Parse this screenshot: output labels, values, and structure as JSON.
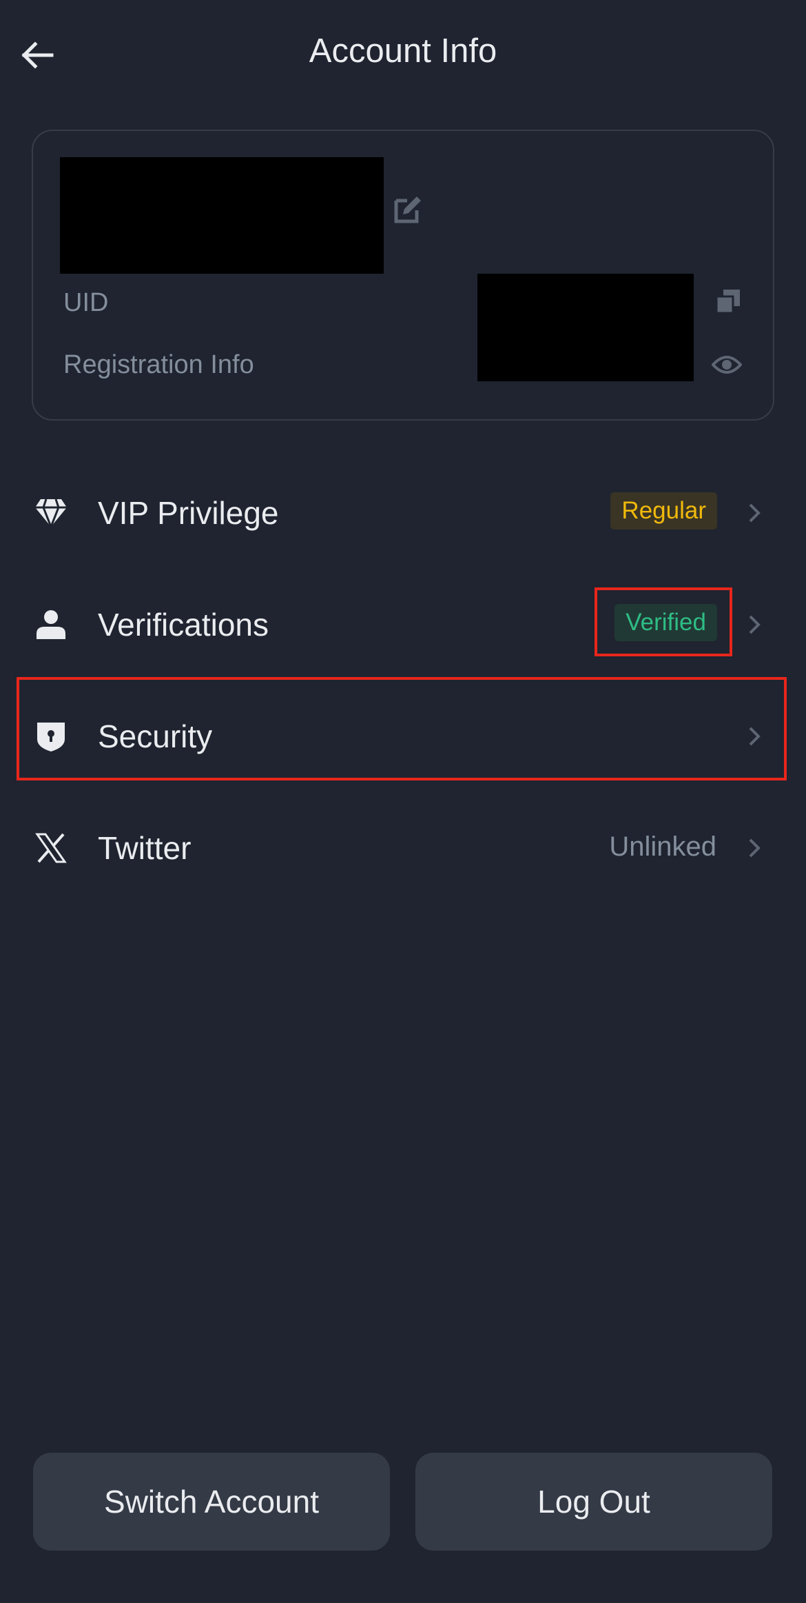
{
  "header": {
    "title": "Account Info",
    "back_icon": "arrow-left-icon"
  },
  "profile_card": {
    "uid_label": "UID",
    "registration_label": "Registration Info",
    "edit_icon": "edit-icon",
    "copy_icon": "copy-icon",
    "eye_icon": "eye-icon"
  },
  "menu": {
    "items": [
      {
        "label": "VIP Privilege",
        "icon": "diamond-icon",
        "badge": "Regular"
      },
      {
        "label": "Verifications",
        "icon": "user-icon",
        "badge": "Verified"
      },
      {
        "label": "Security",
        "icon": "shield-icon"
      },
      {
        "label": "Twitter",
        "icon": "x-logo-icon",
        "value": "Unlinked"
      }
    ]
  },
  "footer": {
    "switch_account_label": "Switch Account",
    "logout_label": "Log Out"
  },
  "colors": {
    "background": "#1f2430",
    "regular_badge_text": "#f0b90b",
    "verified_badge_text": "#2ebd85",
    "muted_text": "#848e9c",
    "annotation_red": "#e8261c"
  }
}
